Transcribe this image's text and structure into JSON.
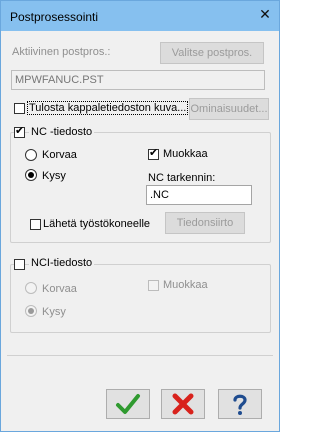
{
  "window": {
    "title": "Postprosessointi",
    "close_glyph": "✕"
  },
  "active": {
    "label": "Aktiivinen postpros.:",
    "select_button": "Valitse postpros.",
    "value": "MPWFANUC.PST"
  },
  "print": {
    "label": "Tulosta kappaletiedoston kuva...",
    "properties_button": "Ominaisuudet..."
  },
  "nc": {
    "group_label": "NC -tiedosto",
    "replace_label": "Korvaa",
    "ask_label": "Kysy",
    "edit_label": "Muokkaa",
    "ext_label": "NC tarkennin:",
    "ext_value": ".NC",
    "send_label": "Lähetä työstökoneelle",
    "transfer_button": "Tiedonsiirto"
  },
  "nci": {
    "group_label": "NCI-tiedosto",
    "replace_label": "Korvaa",
    "ask_label": "Kysy",
    "edit_label": "Muokkaa"
  },
  "footer": {
    "ok_icon": "check-icon",
    "cancel_icon": "cross-icon",
    "help_icon": "question-icon"
  },
  "colors": {
    "ok": "#2f9a2f",
    "cancel": "#d8221c",
    "help": "#1f4c8f",
    "title_bar": "#86c0ef"
  }
}
